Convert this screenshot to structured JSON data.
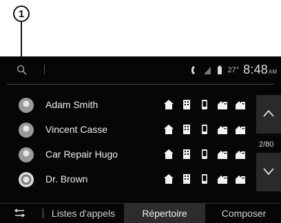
{
  "callout": {
    "number": "1"
  },
  "status": {
    "temperature": "27°",
    "time": "8:48",
    "ampm": "AM"
  },
  "contacts": [
    {
      "name": "Adam Smith",
      "avatar": "person"
    },
    {
      "name": "Vincent Casse",
      "avatar": "person"
    },
    {
      "name": "Car Repair Hugo",
      "avatar": "person"
    },
    {
      "name": "Dr. Brown",
      "avatar": "logo"
    }
  ],
  "contact_icons": [
    "home-phone-icon",
    "office-phone-icon",
    "mobile-phone-icon",
    "home-office-icon",
    "home-office-icon"
  ],
  "pagination": {
    "text": "2/80"
  },
  "tabs": {
    "call_logs": "Listes d'appels",
    "directory": "Répertoire",
    "dial": "Composer",
    "active": "directory"
  },
  "colors": {
    "background": "#060606",
    "text": "#e8e8e8",
    "active_tab": "#2c2c2c"
  }
}
